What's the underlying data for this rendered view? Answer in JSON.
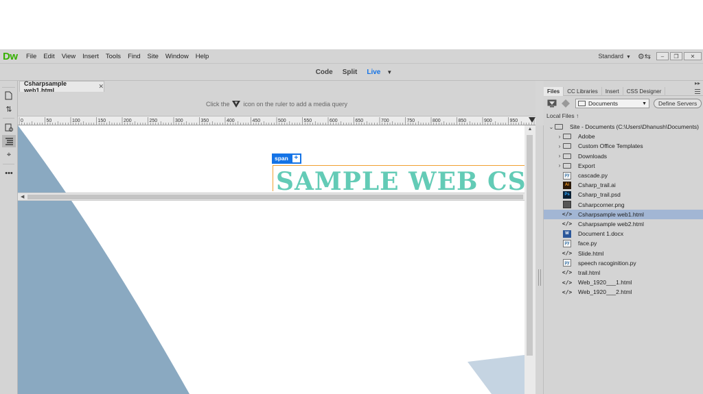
{
  "app": {
    "logo": "Dw",
    "menu": [
      "File",
      "Edit",
      "View",
      "Insert",
      "Tools",
      "Find",
      "Site",
      "Window",
      "Help"
    ],
    "workspace": "Standard"
  },
  "views": {
    "code": "Code",
    "split": "Split",
    "live": "Live",
    "active": "Live"
  },
  "document": {
    "tab": "Csharpsample web1.html",
    "media_query_hint_before": "Click the",
    "media_query_hint_after": "icon on the ruler to add a media query",
    "ruler_labels": [
      "0",
      "50",
      "100",
      "150",
      "200",
      "250",
      "300",
      "350",
      "400",
      "450",
      "500",
      "550",
      "600",
      "650",
      "700",
      "750",
      "800",
      "850",
      "900",
      "950",
      "100"
    ],
    "element_tag": "span",
    "heading": "SAMPLE WEB CS"
  },
  "panel": {
    "tabs": [
      "Files",
      "CC Libraries",
      "Insert",
      "CSS Designer"
    ],
    "active_tab": "Files",
    "location": "Documents",
    "define_servers": "Define Servers",
    "local_files": "Local Files",
    "site_root": "Site - Documents (C:\\Users\\Dhanush\\Documents)",
    "items": [
      {
        "name": "Adobe",
        "type": "folder"
      },
      {
        "name": "Custom Office Templates",
        "type": "folder"
      },
      {
        "name": "Downloads",
        "type": "folder"
      },
      {
        "name": "Export",
        "type": "folder"
      },
      {
        "name": "cascade.py",
        "type": "py"
      },
      {
        "name": "Csharp_trail.ai",
        "type": "ai"
      },
      {
        "name": "Csharp_trail.psd",
        "type": "ps"
      },
      {
        "name": "Csharpcorner.png",
        "type": "img"
      },
      {
        "name": "Csharpsample web1.html",
        "type": "code",
        "selected": true
      },
      {
        "name": "Csharpsample web2.html",
        "type": "code"
      },
      {
        "name": "Document 1.docx",
        "type": "doc"
      },
      {
        "name": "face.py",
        "type": "py"
      },
      {
        "name": "Slide.html",
        "type": "code"
      },
      {
        "name": "speech racoginition.py",
        "type": "py"
      },
      {
        "name": "trail.html",
        "type": "code"
      },
      {
        "name": "Web_1920___1.html",
        "type": "code"
      },
      {
        "name": "Web_1920___2.html",
        "type": "code"
      }
    ]
  },
  "colors": {
    "accent": "#1473e6",
    "heading": "#63cbb6",
    "selection": "#a2b6d4",
    "logo": "#35b000"
  }
}
